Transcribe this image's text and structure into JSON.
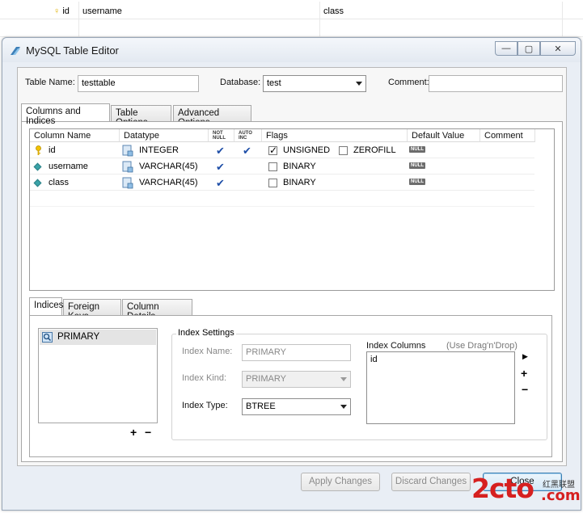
{
  "background_table": {
    "row": {
      "key_col": "id",
      "col1": "username",
      "col2": "class"
    }
  },
  "window": {
    "title": "MySQL Table Editor",
    "min_icon": "minimize-icon",
    "max_icon": "maximize-icon",
    "close_icon": "close-icon",
    "close_glyph": "✕",
    "restore_glyph": "▢",
    "min_glyph": "—"
  },
  "form": {
    "table_name_label": "Table Name:",
    "table_name_value": "testtable",
    "database_label": "Database:",
    "database_value": "test",
    "comment_label": "Comment:",
    "comment_value": ""
  },
  "tabs": {
    "columns": "Columns and Indices",
    "table_options": "Table Options",
    "advanced": "Advanced Options"
  },
  "grid": {
    "headers": {
      "column_name": "Column Name",
      "datatype": "Datatype",
      "not_null": "NOT NULL",
      "auto_inc": "AUTO INC",
      "flags": "Flags",
      "default_value": "Default Value",
      "comment": "Comment"
    },
    "rows": [
      {
        "name": "id",
        "type": "INTEGER",
        "not_null": true,
        "auto_inc": true,
        "flag1": "UNSIGNED",
        "flag1_checked": true,
        "flag2": "ZEROFILL",
        "flag2_checked": false,
        "default": "NULL",
        "primary": true
      },
      {
        "name": "username",
        "type": "VARCHAR(45)",
        "not_null": true,
        "auto_inc": false,
        "flag1": "BINARY",
        "flag1_checked": false,
        "default": "NULL",
        "primary": false
      },
      {
        "name": "class",
        "type": "VARCHAR(45)",
        "not_null": true,
        "auto_inc": false,
        "flag1": "BINARY",
        "flag1_checked": false,
        "default": "NULL",
        "primary": false
      }
    ],
    "check_glyph": "✔"
  },
  "lower_tabs": {
    "indices": "Indices",
    "foreign_keys": "Foreign Keys",
    "column_details": "Column Details"
  },
  "indices": {
    "list": [
      "PRIMARY"
    ],
    "add_glyph": "+",
    "remove_glyph": "−"
  },
  "index_settings": {
    "title": "Index Settings",
    "name_label": "Index Name:",
    "name_value": "PRIMARY",
    "kind_label": "Index Kind:",
    "kind_value": "PRIMARY",
    "type_label": "Index Type:",
    "type_value": "BTREE",
    "columns_label": "Index Columns",
    "columns_hint": "(Use Drag'n'Drop)",
    "columns": [
      "id"
    ],
    "move_glyph": "▶",
    "add_glyph": "+",
    "remove_glyph": "−"
  },
  "buttons": {
    "apply": "Apply Changes",
    "discard": "Discard Changes",
    "close": "Close"
  },
  "watermark": {
    "brand": "2cto",
    "suffix": ".com",
    "cn": "红黑联盟"
  }
}
